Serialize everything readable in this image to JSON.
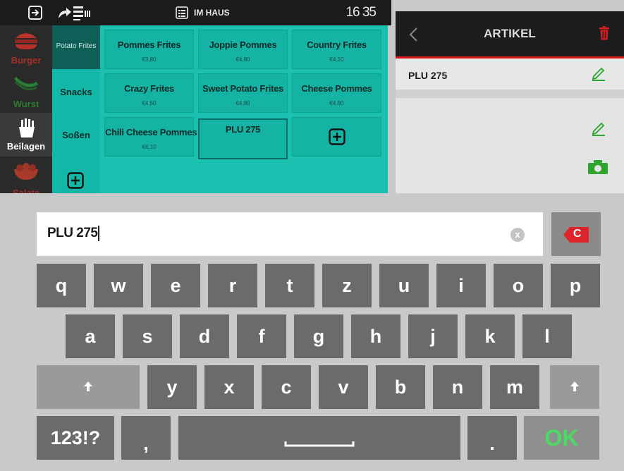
{
  "topbar": {
    "mode_label": "IM HAUS",
    "clock": "16 35"
  },
  "categories": [
    {
      "label": "Burger",
      "color": "#c43a2f"
    },
    {
      "label": "Wurst",
      "color": "#2f8f3a"
    },
    {
      "label": "Beilagen",
      "color": "#ffffff"
    },
    {
      "label": "Salate",
      "color": "#c43a2f"
    }
  ],
  "subcategories": [
    "Potato Frites",
    "Snacks",
    "Soßen"
  ],
  "products": [
    {
      "name": "Pommes Frites",
      "price": "€3,80"
    },
    {
      "name": "Joppie Pommes",
      "price": "€4,80"
    },
    {
      "name": "Country Frites",
      "price": "€4,10"
    },
    {
      "name": "Crazy Frites",
      "price": "€4,50"
    },
    {
      "name": "Sweet Potato Frites",
      "price": "€4,80"
    },
    {
      "name": "Cheese Pommes",
      "price": "€4,80"
    },
    {
      "name": "Chili Cheese Pommes",
      "price": "€6,10"
    },
    {
      "name": "PLU 275",
      "price": ""
    }
  ],
  "article_panel": {
    "title": "ARTIKEL",
    "item_name": "PLU 275"
  },
  "keyboard": {
    "input_value": "PLU 275",
    "row1": [
      "q",
      "w",
      "e",
      "r",
      "t",
      "z",
      "u",
      "i",
      "o",
      "p"
    ],
    "row2": [
      "a",
      "s",
      "d",
      "f",
      "g",
      "h",
      "j",
      "k",
      "l"
    ],
    "row3": [
      "y",
      "x",
      "c",
      "v",
      "b",
      "n",
      "m"
    ],
    "numbers_label": "123!?",
    "comma_label": ",",
    "period_label": ".",
    "ok_label": "OK",
    "delete_icon": "C",
    "clear_icon": "x",
    "ok_color": "#4cd964",
    "accent_red": "#e0242b"
  }
}
